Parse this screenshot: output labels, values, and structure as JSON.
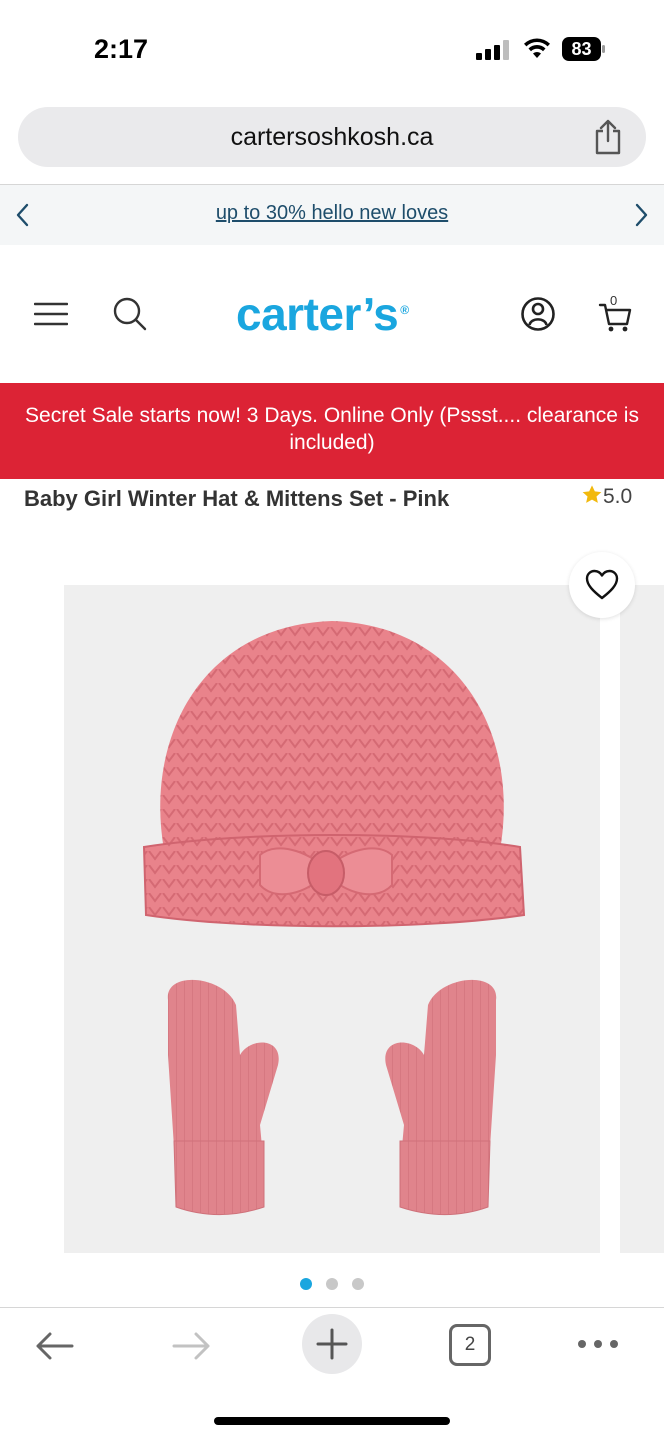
{
  "status_bar": {
    "time": "2:17",
    "battery": "83"
  },
  "browser": {
    "url": "cartersoshkosh.ca",
    "open_tabs": "2"
  },
  "promo": {
    "text": "up to 30% hello new loves"
  },
  "header": {
    "logo": "carter’s",
    "logo_mark": "®",
    "cart_count": "0"
  },
  "sale_banner": {
    "text": "Secret Sale starts now! 3 Days. Online Only (Pssst.... clearance is included)"
  },
  "product": {
    "title": "Baby Girl Winter Hat & Mittens Set - Pink",
    "rating": "5.0",
    "image_count": 3,
    "active_image": 1
  },
  "colors": {
    "brand_blue": "#1aa6df",
    "sale_red": "#dc2335",
    "promo_link": "#1e4d6b",
    "knit_pink": "#e9838b",
    "star": "#f2b90d"
  },
  "icons": [
    "signal-icon",
    "wifi-icon",
    "battery-icon",
    "share-icon",
    "chevron-left-icon",
    "chevron-right-icon",
    "menu-icon",
    "search-icon",
    "account-icon",
    "cart-icon",
    "star-icon",
    "heart-icon",
    "back-arrow-icon",
    "forward-arrow-icon",
    "plus-icon",
    "more-icon"
  ]
}
